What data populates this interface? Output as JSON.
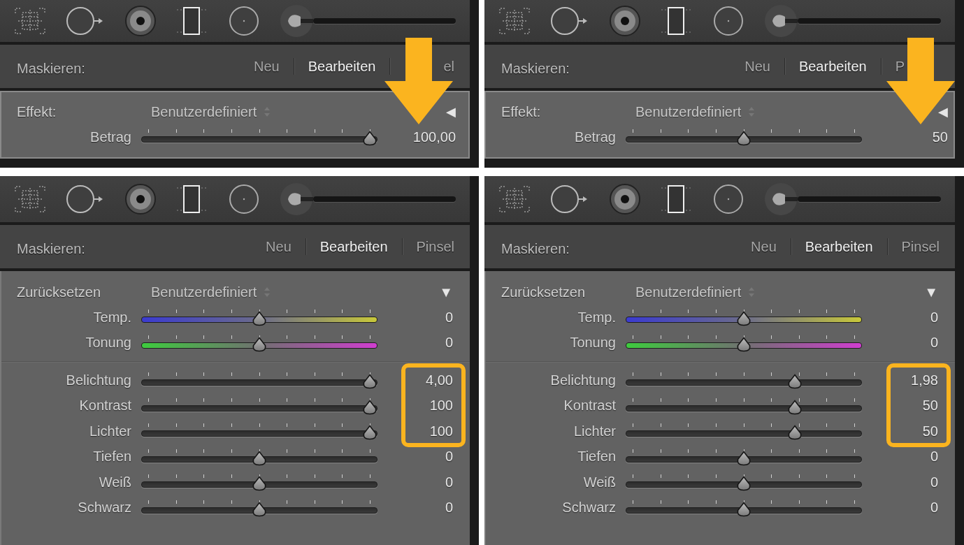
{
  "panels": [
    {
      "arrow": true,
      "mask": {
        "label": "Maskieren:",
        "modes": [
          {
            "label": "Neu",
            "selected": false
          },
          {
            "label": "Bearbeiten",
            "selected": true
          },
          {
            "label": "el",
            "selected": false
          }
        ]
      },
      "section": {
        "kind": "effect",
        "label": "Effekt:",
        "preset": "Benutzerdefiniert",
        "toggle": "◀",
        "groups": [
          [
            {
              "label": "Betrag",
              "kind": "plain",
              "level": 1.0,
              "reading": "100,00",
              "highlighted": false
            }
          ]
        ]
      }
    },
    {
      "arrow": true,
      "mask": {
        "label": "Maskieren:",
        "modes": [
          {
            "label": "Neu",
            "selected": false
          },
          {
            "label": "Bearbeiten",
            "selected": true
          },
          {
            "label": "P",
            "selected": false
          }
        ]
      },
      "section": {
        "kind": "effect",
        "label": "Effekt:",
        "preset": "Benutzerdefiniert",
        "toggle": "◀",
        "groups": [
          [
            {
              "label": "Betrag",
              "kind": "plain",
              "level": 0.5,
              "reading": "50",
              "highlighted": false
            }
          ]
        ]
      }
    },
    {
      "arrow": false,
      "mask": {
        "label": "Maskieren:",
        "modes": [
          {
            "label": "Neu",
            "selected": false
          },
          {
            "label": "Bearbeiten",
            "selected": true
          },
          {
            "label": "Pinsel",
            "selected": false
          }
        ]
      },
      "section": {
        "kind": "adjust",
        "label": "Zurücksetzen",
        "preset": "Benutzerdefiniert",
        "toggle": "▼",
        "groups": [
          [
            {
              "label": "Temp.",
              "kind": "temp",
              "level": 0.5,
              "reading": "0",
              "highlighted": false
            },
            {
              "label": "Tonung",
              "kind": "tint",
              "level": 0.5,
              "reading": "0",
              "highlighted": false
            }
          ],
          [
            {
              "label": "Belichtung",
              "kind": "plain",
              "level": 1.0,
              "reading": "4,00",
              "highlighted": true
            },
            {
              "label": "Kontrast",
              "kind": "plain",
              "level": 1.0,
              "reading": "100",
              "highlighted": true
            },
            {
              "label": "Lichter",
              "kind": "plain",
              "level": 1.0,
              "reading": "100",
              "highlighted": true
            },
            {
              "label": "Tiefen",
              "kind": "plain",
              "level": 0.5,
              "reading": "0",
              "highlighted": false
            },
            {
              "label": "Weiß",
              "kind": "plain",
              "level": 0.5,
              "reading": "0",
              "highlighted": false
            },
            {
              "label": "Schwarz",
              "kind": "plain",
              "level": 0.5,
              "reading": "0",
              "highlighted": false
            }
          ]
        ]
      }
    },
    {
      "arrow": false,
      "mask": {
        "label": "Maskieren:",
        "modes": [
          {
            "label": "Neu",
            "selected": false
          },
          {
            "label": "Bearbeiten",
            "selected": true
          },
          {
            "label": "Pinsel",
            "selected": false
          }
        ]
      },
      "section": {
        "kind": "adjust",
        "label": "Zurücksetzen",
        "preset": "Benutzerdefiniert",
        "toggle": "▼",
        "groups": [
          [
            {
              "label": "Temp.",
              "kind": "temp",
              "level": 0.5,
              "reading": "0",
              "highlighted": false
            },
            {
              "label": "Tonung",
              "kind": "tint",
              "level": 0.5,
              "reading": "0",
              "highlighted": false
            }
          ],
          [
            {
              "label": "Belichtung",
              "kind": "plain",
              "level": 0.73,
              "reading": "1,98",
              "highlighted": true
            },
            {
              "label": "Kontrast",
              "kind": "plain",
              "level": 0.73,
              "reading": "50",
              "highlighted": true
            },
            {
              "label": "Lichter",
              "kind": "plain",
              "level": 0.73,
              "reading": "50",
              "highlighted": true
            },
            {
              "label": "Tiefen",
              "kind": "plain",
              "level": 0.5,
              "reading": "0",
              "highlighted": false
            },
            {
              "label": "Weiß",
              "kind": "plain",
              "level": 0.5,
              "reading": "0",
              "highlighted": false
            },
            {
              "label": "Schwarz",
              "kind": "plain",
              "level": 0.5,
              "reading": "0",
              "highlighted": false
            }
          ]
        ]
      }
    }
  ]
}
